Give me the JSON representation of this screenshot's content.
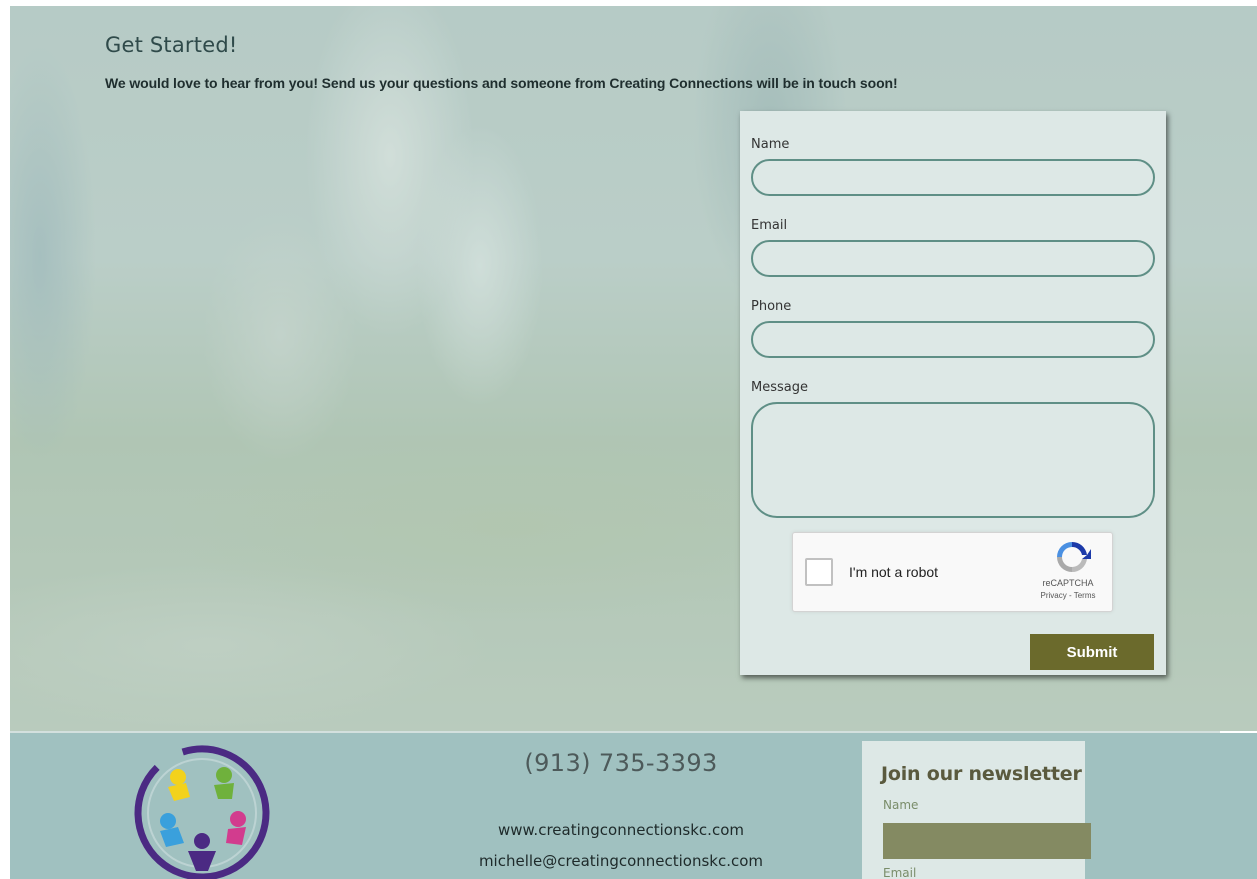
{
  "hero": {
    "title": "Get Started!",
    "intro": "We would love to hear from you!  Send us your questions and someone from Creating Connections will be in touch soon!"
  },
  "form": {
    "fields": {
      "name": {
        "label": "Name",
        "value": ""
      },
      "email": {
        "label": "Email",
        "value": ""
      },
      "phone": {
        "label": "Phone",
        "value": ""
      },
      "message": {
        "label": "Message",
        "value": ""
      }
    },
    "captcha": {
      "label": "I'm not a robot",
      "brand": "reCAPTCHA",
      "links": "Privacy - Terms"
    },
    "submit_label": "Submit"
  },
  "footer": {
    "phone": "(913) 735-3393",
    "website": "www.creatingconnectionskc.com",
    "email": "michelle@creatingconnectionskc.com",
    "newsletter": {
      "title": "Join our newsletter",
      "name_label": "Name",
      "email_label": "Email"
    }
  },
  "colors": {
    "accent_button": "#6b6a2c",
    "field_border": "#5f8f86",
    "footer_bg": "#a0c1c0",
    "form_bg": "#dde8e6"
  }
}
